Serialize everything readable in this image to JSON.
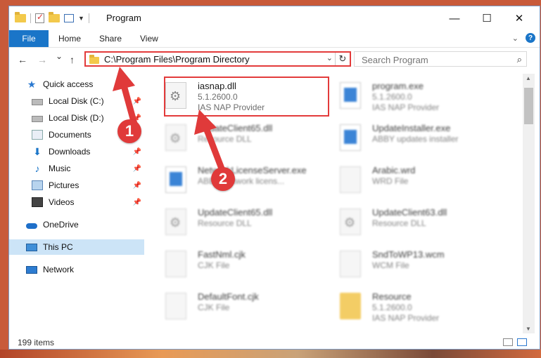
{
  "window": {
    "title": "Program",
    "controls": {
      "minimize": "—",
      "maximize": "☐",
      "close": "✕"
    }
  },
  "ribbon": {
    "tabs": [
      "File",
      "Home",
      "Share",
      "View"
    ],
    "expand_icon": "chevron-down-icon",
    "help": "?"
  },
  "navigation": {
    "back": "←",
    "forward": "→",
    "recent": "⌄",
    "up": "↑",
    "address": "C:\\Program Files\\Program Directory",
    "search_placeholder": "Search Program"
  },
  "sidebar": {
    "items": [
      {
        "label": "Quick access",
        "icon": "star-icon"
      },
      {
        "label": "Local Disk (C:)",
        "icon": "drive-icon",
        "pinned": true
      },
      {
        "label": "Local Disk (D:)",
        "icon": "drive-icon",
        "pinned": true
      },
      {
        "label": "Documents",
        "icon": "documents-icon",
        "pinned": true
      },
      {
        "label": "Downloads",
        "icon": "downloads-icon",
        "pinned": true
      },
      {
        "label": "Music",
        "icon": "music-icon",
        "pinned": true
      },
      {
        "label": "Pictures",
        "icon": "pictures-icon",
        "pinned": true
      },
      {
        "label": "Videos",
        "icon": "videos-icon",
        "pinned": true
      },
      {
        "label": "OneDrive",
        "icon": "onedrive-icon"
      },
      {
        "label": "This PC",
        "icon": "this-pc-icon",
        "selected": true
      },
      {
        "label": "Network",
        "icon": "network-icon"
      }
    ]
  },
  "files": [
    {
      "name": "iasnap.dll",
      "line2": "5.1.2600.0",
      "line3": "IAS NAP Provider",
      "icon": "dll-gear-icon"
    },
    {
      "name": "program.exe",
      "line2": "5.1.2600.0",
      "line3": "IAS NAP Provider",
      "icon": "exe-icon"
    },
    {
      "name": "UpdateClient65.dll",
      "line2": "Resource DLL",
      "line3": "",
      "icon": "dll-gear-icon"
    },
    {
      "name": "UpdateInstaller.exe",
      "line2": "ABBY updates installer",
      "line3": "",
      "icon": "exe-icon"
    },
    {
      "name": "NetworkLicenseServer.exe",
      "line2": "ABBY Network licens...",
      "line3": "",
      "icon": "exe-icon"
    },
    {
      "name": "Arabic.wrd",
      "line2": "WRD File",
      "line3": "",
      "icon": "blank-file-icon"
    },
    {
      "name": "UpdateClient65.dll",
      "line2": "Resource DLL",
      "line3": "",
      "icon": "dll-gear-icon"
    },
    {
      "name": "UpdateClient63.dll",
      "line2": "Resource DLL",
      "line3": "",
      "icon": "dll-gear-icon"
    },
    {
      "name": "FastNml.cjk",
      "line2": "CJK File",
      "line3": "",
      "icon": "blank-file-icon"
    },
    {
      "name": "SndToWP13.wcm",
      "line2": "WCM File",
      "line3": "",
      "icon": "blank-file-icon"
    },
    {
      "name": "DefaultFont.cjk",
      "line2": "CJK File",
      "line3": "",
      "icon": "blank-file-icon"
    },
    {
      "name": "Resource",
      "line2": "5.1.2600.0",
      "line3": "IAS NAP Provider",
      "icon": "folder-zip-icon"
    }
  ],
  "status": {
    "items_count": "199 items"
  },
  "annotations": [
    {
      "label": "1"
    },
    {
      "label": "2"
    }
  ],
  "colors": {
    "accent": "#1a75c8",
    "highlight": "#e33b3b",
    "selected": "#cce4f7"
  }
}
